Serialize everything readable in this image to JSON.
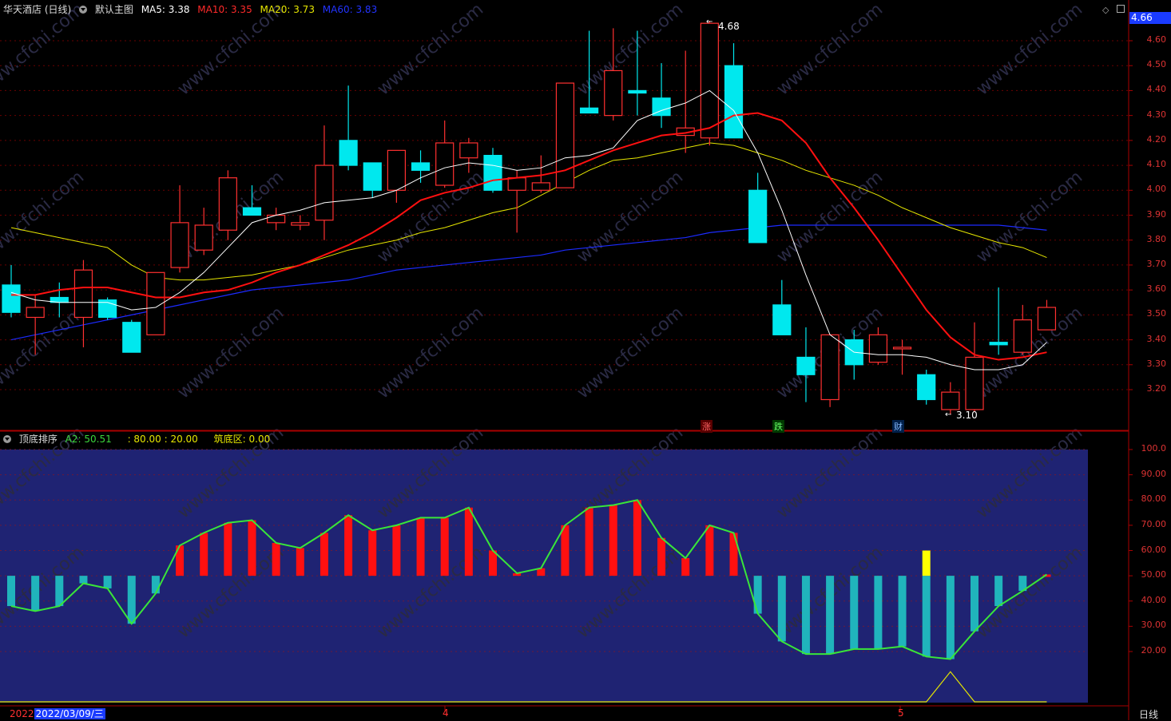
{
  "header": {
    "stock_title": "华天酒店 (日线)",
    "main_label": "默认主图",
    "ma5": "MA5: 3.38",
    "ma10": "MA10: 3.35",
    "ma20": "MA20: 3.73",
    "ma60": "MA60: 3.83",
    "current_price": "4.66"
  },
  "indicator_header": {
    "name": "顶底排序",
    "a2": "A2: 50.51",
    "levels": ": 80.00 : 20.00",
    "bottom_zone": "筑底区: 0.00"
  },
  "annotations": {
    "high": "4.68",
    "low": "3.10",
    "mark_up": "涨",
    "mark_down": "跌",
    "mark_fin": "财"
  },
  "footer": {
    "year": "2022",
    "cursor_date": "2022/03/09/三",
    "month4": "4",
    "month5": "5",
    "period": "日线"
  },
  "colors": {
    "up": "#ff3030",
    "down": "#00e8ee",
    "ma5": "#ffffff",
    "ma10": "#ff1010",
    "ma20": "#e6e600",
    "ma60": "#1c2bff",
    "panel_bg": "#1f2373",
    "accent_price": "#1a3bff"
  },
  "price_axis": [
    "4.60",
    "4.50",
    "4.40",
    "4.30",
    "4.20",
    "4.10",
    "4.00",
    "3.90",
    "3.80",
    "3.70",
    "3.60",
    "3.50",
    "3.40",
    "3.30",
    "3.20"
  ],
  "indicator_axis": [
    "100.0",
    "90.00",
    "80.00",
    "70.00",
    "60.00",
    "50.00",
    "40.00",
    "30.00",
    "20.00"
  ],
  "chart_data": [
    {
      "type": "candlestick",
      "title": "华天酒店 (日线)",
      "ylim": [
        3.08,
        4.72
      ],
      "candles": [
        {
          "o": 3.62,
          "c": 3.51,
          "h": 3.7,
          "l": 3.49
        },
        {
          "o": 3.49,
          "c": 3.53,
          "h": 3.58,
          "l": 3.34
        },
        {
          "o": 3.57,
          "c": 3.55,
          "h": 3.63,
          "l": 3.49
        },
        {
          "o": 3.49,
          "c": 3.68,
          "h": 3.72,
          "l": 3.37
        },
        {
          "o": 3.56,
          "c": 3.49,
          "h": 3.57,
          "l": 3.48
        },
        {
          "o": 3.47,
          "c": 3.35,
          "h": 3.48,
          "l": 3.35
        },
        {
          "o": 3.42,
          "c": 3.67,
          "h": 3.67,
          "l": 3.42
        },
        {
          "o": 3.69,
          "c": 3.87,
          "h": 4.02,
          "l": 3.67
        },
        {
          "o": 3.76,
          "c": 3.86,
          "h": 3.93,
          "l": 3.74
        },
        {
          "o": 3.84,
          "c": 4.05,
          "h": 4.08,
          "l": 3.8
        },
        {
          "o": 3.93,
          "c": 3.9,
          "h": 4.02,
          "l": 3.9
        },
        {
          "o": 3.87,
          "c": 3.9,
          "h": 3.93,
          "l": 3.84
        },
        {
          "o": 3.86,
          "c": 3.87,
          "h": 3.9,
          "l": 3.84
        },
        {
          "o": 3.88,
          "c": 4.1,
          "h": 4.26,
          "l": 3.8
        },
        {
          "o": 4.2,
          "c": 4.1,
          "h": 4.42,
          "l": 4.08
        },
        {
          "o": 4.11,
          "c": 4.0,
          "h": 4.11,
          "l": 3.97
        },
        {
          "o": 4.0,
          "c": 4.16,
          "h": 4.16,
          "l": 3.95
        },
        {
          "o": 4.11,
          "c": 4.08,
          "h": 4.16,
          "l": 4.03
        },
        {
          "o": 4.02,
          "c": 4.19,
          "h": 4.28,
          "l": 4.01
        },
        {
          "o": 4.13,
          "c": 4.19,
          "h": 4.21,
          "l": 4.07
        },
        {
          "o": 4.14,
          "c": 4.0,
          "h": 4.17,
          "l": 3.99
        },
        {
          "o": 4.0,
          "c": 4.05,
          "h": 4.08,
          "l": 3.83
        },
        {
          "o": 4.0,
          "c": 4.03,
          "h": 4.14,
          "l": 3.99
        },
        {
          "o": 4.01,
          "c": 4.43,
          "h": 4.43,
          "l": 4.01
        },
        {
          "o": 4.33,
          "c": 4.31,
          "h": 4.64,
          "l": 4.31
        },
        {
          "o": 4.3,
          "c": 4.48,
          "h": 4.65,
          "l": 4.28
        },
        {
          "o": 4.4,
          "c": 4.39,
          "h": 4.64,
          "l": 4.3
        },
        {
          "o": 4.37,
          "c": 4.3,
          "h": 4.51,
          "l": 4.25
        },
        {
          "o": 4.22,
          "c": 4.25,
          "h": 4.56,
          "l": 4.15
        },
        {
          "o": 4.21,
          "c": 4.67,
          "h": 4.68,
          "l": 4.18
        },
        {
          "o": 4.5,
          "c": 4.21,
          "h": 4.59,
          "l": 4.21
        },
        {
          "o": 4.0,
          "c": 3.79,
          "h": 4.07,
          "l": 3.79
        },
        {
          "o": 3.54,
          "c": 3.42,
          "h": 3.64,
          "l": 3.42
        },
        {
          "o": 3.33,
          "c": 3.26,
          "h": 3.45,
          "l": 3.15
        },
        {
          "o": 3.16,
          "c": 3.42,
          "h": 3.42,
          "l": 3.13
        },
        {
          "o": 3.4,
          "c": 3.3,
          "h": 3.44,
          "l": 3.24
        },
        {
          "o": 3.31,
          "c": 3.42,
          "h": 3.45,
          "l": 3.3
        },
        {
          "o": 3.37,
          "c": 3.37,
          "h": 3.4,
          "l": 3.26
        },
        {
          "o": 3.26,
          "c": 3.16,
          "h": 3.28,
          "l": 3.14
        },
        {
          "o": 3.12,
          "c": 3.19,
          "h": 3.23,
          "l": 3.1
        },
        {
          "o": 3.12,
          "c": 3.33,
          "h": 3.47,
          "l": 3.11
        },
        {
          "o": 3.39,
          "c": 3.38,
          "h": 3.61,
          "l": 3.34
        },
        {
          "o": 3.35,
          "c": 3.48,
          "h": 3.54,
          "l": 3.34
        },
        {
          "o": 3.44,
          "c": 3.53,
          "h": 3.56,
          "l": 3.44
        }
      ],
      "ma5": [
        3.59,
        3.56,
        3.55,
        3.55,
        3.55,
        3.52,
        3.53,
        3.59,
        3.67,
        3.77,
        3.87,
        3.9,
        3.92,
        3.95,
        3.96,
        3.97,
        4.0,
        4.05,
        4.09,
        4.11,
        4.1,
        4.08,
        4.09,
        4.13,
        4.14,
        4.17,
        4.28,
        4.32,
        4.35,
        4.4,
        4.32,
        4.15,
        3.92,
        3.66,
        3.42,
        3.35,
        3.34,
        3.34,
        3.33,
        3.3,
        3.28,
        3.28,
        3.3,
        3.39
      ],
      "ma10": [
        3.58,
        3.58,
        3.6,
        3.61,
        3.61,
        3.59,
        3.57,
        3.57,
        3.59,
        3.6,
        3.63,
        3.67,
        3.7,
        3.74,
        3.78,
        3.83,
        3.89,
        3.96,
        3.99,
        4.01,
        4.04,
        4.05,
        4.06,
        4.08,
        4.12,
        4.16,
        4.19,
        4.22,
        4.23,
        4.25,
        4.3,
        4.31,
        4.28,
        4.19,
        4.05,
        3.93,
        3.8,
        3.66,
        3.52,
        3.41,
        3.34,
        3.32,
        3.33,
        3.35
      ],
      "ma20": [
        3.85,
        3.83,
        3.81,
        3.79,
        3.77,
        3.7,
        3.65,
        3.64,
        3.64,
        3.65,
        3.66,
        3.68,
        3.7,
        3.73,
        3.76,
        3.78,
        3.8,
        3.83,
        3.85,
        3.88,
        3.91,
        3.93,
        3.98,
        4.03,
        4.08,
        4.12,
        4.13,
        4.15,
        4.17,
        4.19,
        4.18,
        4.15,
        4.12,
        4.08,
        4.05,
        4.02,
        3.98,
        3.93,
        3.89,
        3.85,
        3.82,
        3.79,
        3.77,
        3.73
      ],
      "ma60": [
        3.4,
        3.42,
        3.44,
        3.46,
        3.48,
        3.5,
        3.52,
        3.54,
        3.56,
        3.58,
        3.6,
        3.61,
        3.62,
        3.63,
        3.64,
        3.66,
        3.68,
        3.69,
        3.7,
        3.71,
        3.72,
        3.73,
        3.74,
        3.76,
        3.77,
        3.78,
        3.79,
        3.8,
        3.81,
        3.83,
        3.84,
        3.85,
        3.86,
        3.86,
        3.86,
        3.86,
        3.86,
        3.86,
        3.86,
        3.86,
        3.86,
        3.86,
        3.85,
        3.84
      ]
    },
    {
      "type": "bar",
      "title": "顶底排序",
      "ylim": [
        0,
        100
      ],
      "baseline": 50,
      "values": [
        38,
        36,
        38,
        47,
        45,
        31,
        43,
        62,
        67,
        71,
        72,
        63,
        61,
        67,
        74,
        68,
        70,
        73,
        73,
        77,
        60,
        51,
        53,
        70,
        77,
        78,
        80,
        65,
        57,
        70,
        67,
        35,
        24,
        19,
        19,
        21,
        21,
        22,
        18,
        17,
        28,
        38,
        44,
        50.51
      ],
      "highlight_index": 38,
      "highlight_value": 60,
      "bottom_zone_peak": {
        "index": 39,
        "value": 12
      }
    }
  ]
}
